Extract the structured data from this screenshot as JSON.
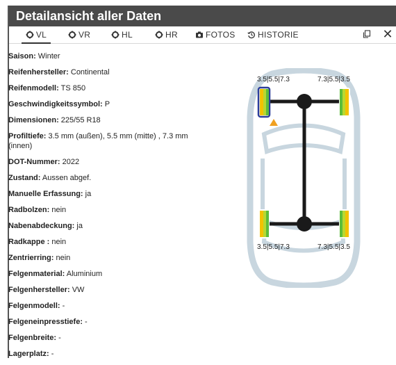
{
  "window": {
    "title": "Detailansicht aller Daten"
  },
  "tabs": [
    {
      "label": "VL",
      "icon": "gear-icon",
      "active": true
    },
    {
      "label": "VR",
      "icon": "gear-icon",
      "active": false
    },
    {
      "label": "HL",
      "icon": "gear-icon",
      "active": false
    },
    {
      "label": "HR",
      "icon": "gear-icon",
      "active": false
    },
    {
      "label": "FOTOS",
      "icon": "camera-icon",
      "active": false
    },
    {
      "label": "HISTORIE",
      "icon": "history-icon",
      "active": false
    }
  ],
  "toolbar": {
    "copy_icon": "copy-icon",
    "close_icon": "close-icon"
  },
  "details": [
    {
      "key": "Saison:",
      "value": "Winter"
    },
    {
      "key": "Reifenhersteller:",
      "value": "Continental"
    },
    {
      "key": "Reifenmodell:",
      "value": "TS 850"
    },
    {
      "key": "Geschwindigkeitssymbol:",
      "value": "P"
    },
    {
      "key": "Dimensionen:",
      "value": "225/55 R18"
    },
    {
      "key": "Profiltiefe:",
      "value": "3.5 mm (außen), 5.5 mm (mitte) , 7.3 mm (innen)"
    },
    {
      "key": "DOT-Nummer:",
      "value": "2022"
    },
    {
      "key": "Zustand:",
      "value": "Aussen abgef."
    },
    {
      "key": "Manuelle Erfassung:",
      "value": "ja"
    },
    {
      "key": "Radbolzen:",
      "value": "nein"
    },
    {
      "key": "Nabenabdeckung:",
      "value": "ja"
    },
    {
      "key": "Radkappe :",
      "value": "nein"
    },
    {
      "key": "Zentrierring:",
      "value": "nein"
    },
    {
      "key": "Felgenmaterial:",
      "value": "Aluminium"
    },
    {
      "key": "Felgenhersteller:",
      "value": "VW"
    },
    {
      "key": "Felgenmodell:",
      "value": "-"
    },
    {
      "key": "Felgeneinpresstiefe:",
      "value": "-"
    },
    {
      "key": "Felgenbreite:",
      "value": "-"
    },
    {
      "key": "Lagerplatz:",
      "value": "-"
    }
  ],
  "wheels": {
    "front_left": "3.5|5.5|7.3",
    "front_right": "7.3|5.5|3.5",
    "rear_left": "3.5|5.5|7.3",
    "rear_right": "7.3|5.5|3.5"
  },
  "colors": {
    "title_bg": "#4a4a4a",
    "car_outline": "#c8d6df",
    "axle": "#1a1a1a",
    "tread_yellow": "#f2c200",
    "tread_green": "#5bbd3a",
    "selected_border": "#2c3e9a",
    "warning": "#f0a020"
  }
}
